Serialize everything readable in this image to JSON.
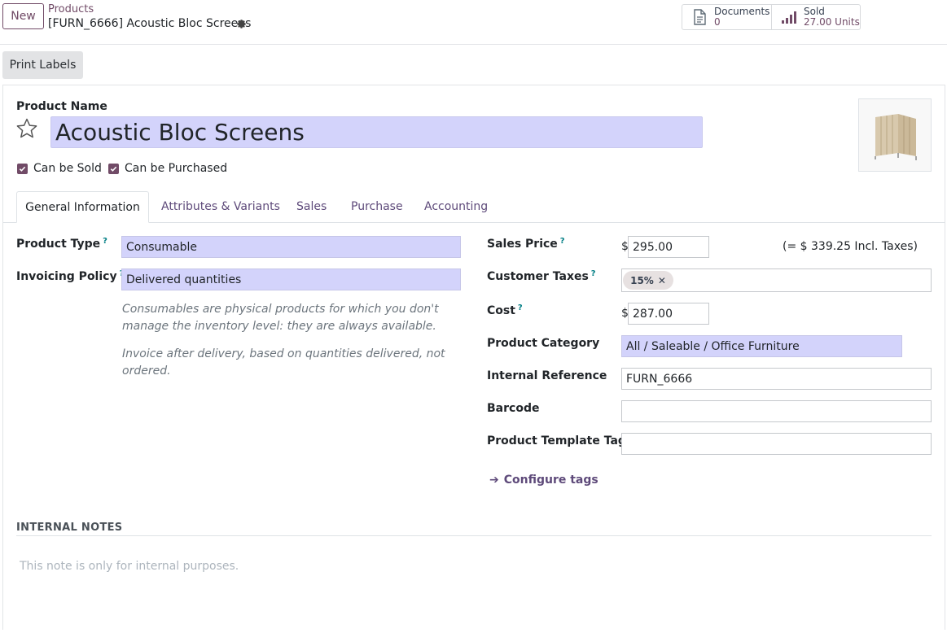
{
  "control_panel": {
    "new_label": "New",
    "breadcrumb_parent": "Products",
    "breadcrumb_current": "[FURN_6666] Acoustic Bloc Screens",
    "smart_buttons": {
      "documents": {
        "label": "Documents",
        "value": "0",
        "icon": "document-icon"
      },
      "sold": {
        "label": "Sold",
        "value": "27.00 Units",
        "icon": "signal-bars-icon"
      }
    },
    "print_labels": "Print Labels"
  },
  "form": {
    "product_name_label": "Product Name",
    "product_name": "Acoustic Bloc Screens",
    "can_be_sold_label": "Can be Sold",
    "can_be_sold": true,
    "can_be_purchased_label": "Can be Purchased",
    "can_be_purchased": true,
    "tabs": [
      "General Information",
      "Attributes & Variants",
      "Sales",
      "Purchase",
      "Accounting"
    ],
    "active_tab": "General Information",
    "left": {
      "product_type_label": "Product Type",
      "product_type": "Consumable",
      "invoicing_policy_label": "Invoicing Policy",
      "invoicing_policy": "Delivered quantities",
      "hint_consumable": "Consumables are physical products for which you don't manage the inventory level: they are always available.",
      "hint_invoice": "Invoice after delivery, based on quantities delivered, not ordered."
    },
    "right": {
      "sales_price_label": "Sales Price",
      "currency": "$",
      "sales_price": "295.00",
      "incl_taxes": "(= $ 339.25 Incl. Taxes)",
      "customer_taxes_label": "Customer Taxes",
      "tax_tag": "15%",
      "cost_label": "Cost",
      "cost": "287.00",
      "category_label": "Product Category",
      "category": "All / Saleable / Office Furniture",
      "internal_ref_label": "Internal Reference",
      "internal_ref": "FURN_6666",
      "barcode_label": "Barcode",
      "barcode": "",
      "tags_label": "Product Template Tags",
      "tags": "",
      "configure_tags": "Configure tags"
    },
    "help_marker": "?",
    "notes_title": "INTERNAL NOTES",
    "notes_placeholder": "This note is only for internal purposes."
  },
  "colors": {
    "brand": "#714b67",
    "required_field": "#d3d3fb",
    "help": "#017e84"
  }
}
